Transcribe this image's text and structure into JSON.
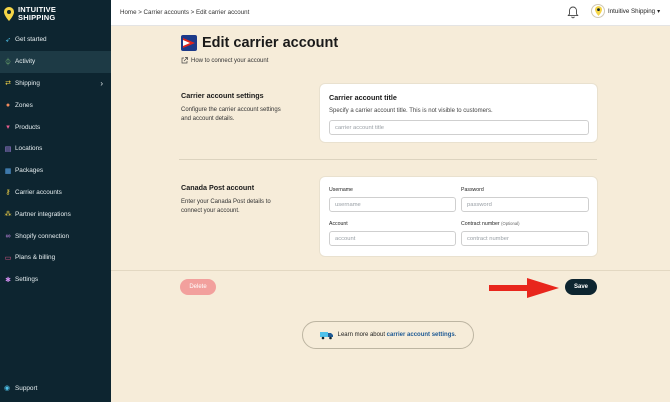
{
  "brand": {
    "line1": "INTUITIVE",
    "line2": "SHIPPING"
  },
  "sidebar": {
    "items": [
      {
        "label": "Get started",
        "icon": "rocket-icon"
      },
      {
        "label": "Activity",
        "icon": "activity-icon",
        "active": true
      },
      {
        "label": "Shipping",
        "icon": "shipping-icon",
        "has_children": true
      },
      {
        "label": "Zones",
        "icon": "globe-icon"
      },
      {
        "label": "Products",
        "icon": "shirt-icon"
      },
      {
        "label": "Locations",
        "icon": "building-icon"
      },
      {
        "label": "Packages",
        "icon": "package-icon"
      },
      {
        "label": "Carrier accounts",
        "icon": "key-icon"
      },
      {
        "label": "Partner integrations",
        "icon": "integrations-icon"
      },
      {
        "label": "Shopify connection",
        "icon": "link-icon"
      },
      {
        "label": "Plans & billing",
        "icon": "billing-icon"
      },
      {
        "label": "Settings",
        "icon": "gear-icon"
      }
    ],
    "support_label": "Support"
  },
  "topbar": {
    "breadcrumb": "Home > Carrier accounts > Edit carrier account",
    "account_name": "Intuitive Shipping",
    "account_caret": "▾"
  },
  "page": {
    "title": "Edit carrier account",
    "howto_link": "How to connect your account"
  },
  "carrier_settings": {
    "heading": "Carrier account settings",
    "description": "Configure the carrier account settings and account details.",
    "card_title": "Carrier account title",
    "card_description": "Specify a carrier account title. This is not visible to customers.",
    "title_placeholder": "carrier account title"
  },
  "canada_post": {
    "heading": "Canada Post account",
    "description": "Enter your Canada Post details to connect your account.",
    "username_label": "Username",
    "username_placeholder": "username",
    "password_label": "Password",
    "password_placeholder": "password",
    "account_label": "Account",
    "account_placeholder": "account",
    "contract_label": "Contract number",
    "contract_optional": "(Optional)",
    "contract_placeholder": "contract number"
  },
  "actions": {
    "delete_label": "Delete",
    "save_label": "Save"
  },
  "learn_more": {
    "prefix": "Learn more about",
    "link": "carrier account settings",
    "suffix": "."
  },
  "colors": {
    "sidebar_bg": "#0d2530",
    "page_bg": "#f6ecd9",
    "save_bg": "#0d2530",
    "delete_bg": "#f2a09d",
    "arrow": "#e8261c",
    "link": "#1f5a94"
  }
}
